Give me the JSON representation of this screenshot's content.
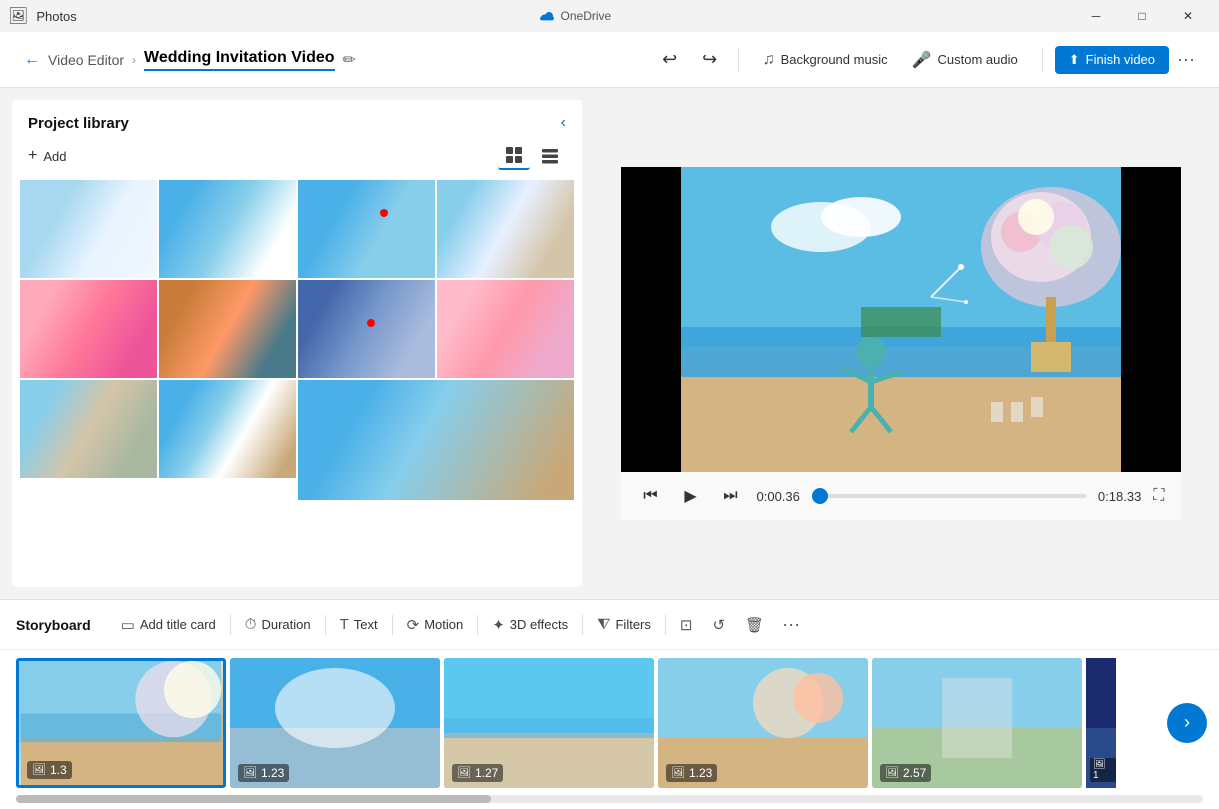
{
  "app": {
    "title": "Photos",
    "onedrive_label": "OneDrive"
  },
  "titlebar": {
    "minimize": "─",
    "maximize": "□",
    "close": "✕"
  },
  "toolbar": {
    "back_label": "Video Editor",
    "project_title": "Wedding Invitation Video",
    "undo_icon": "↩",
    "redo_icon": "↪",
    "bg_music_label": "Background music",
    "custom_audio_label": "Custom audio",
    "finish_label": "Finish video",
    "more_label": "···"
  },
  "library": {
    "title": "Project library",
    "add_label": "Add",
    "collapse_label": "‹",
    "view_grid_label": "⊞",
    "view_list_label": "⊟",
    "thumbnails": [
      {
        "id": 1,
        "color_class": "t1"
      },
      {
        "id": 2,
        "color_class": "t2"
      },
      {
        "id": 3,
        "color_class": "t3"
      },
      {
        "id": 4,
        "color_class": "t4"
      },
      {
        "id": 5,
        "color_class": "t5"
      },
      {
        "id": 6,
        "color_class": "t6"
      },
      {
        "id": 7,
        "color_class": "t7"
      },
      {
        "id": 8,
        "color_class": "t8"
      },
      {
        "id": 9,
        "color_class": "t9"
      },
      {
        "id": 10,
        "color_class": "t10"
      },
      {
        "id": 11,
        "color_class": "t11"
      }
    ]
  },
  "player": {
    "time_current": "0:00.36",
    "time_total": "0:18.33",
    "progress_pct": 3
  },
  "storyboard": {
    "title": "Storyboard",
    "add_title_card": "Add title card",
    "duration_label": "Duration",
    "text_label": "Text",
    "motion_label": "Motion",
    "effects_3d_label": "3D effects",
    "filters_label": "Filters",
    "more_label": "···",
    "clips": [
      {
        "id": 1,
        "duration": "1.3",
        "color_class": "clip-c1",
        "active": true
      },
      {
        "id": 2,
        "duration": "1.23",
        "color_class": "clip-c2",
        "active": false
      },
      {
        "id": 3,
        "duration": "1.27",
        "color_class": "clip-c3",
        "active": false
      },
      {
        "id": 4,
        "duration": "1.23",
        "color_class": "clip-c4",
        "active": false
      },
      {
        "id": 5,
        "duration": "2.57",
        "color_class": "clip-c5",
        "active": false
      },
      {
        "id": 6,
        "duration": "1",
        "color_class": "clip-c1",
        "active": false,
        "partial": true
      }
    ]
  },
  "colors": {
    "accent": "#0078d4",
    "toolbar_bg": "#ffffff",
    "bg": "#f3f3f3"
  }
}
